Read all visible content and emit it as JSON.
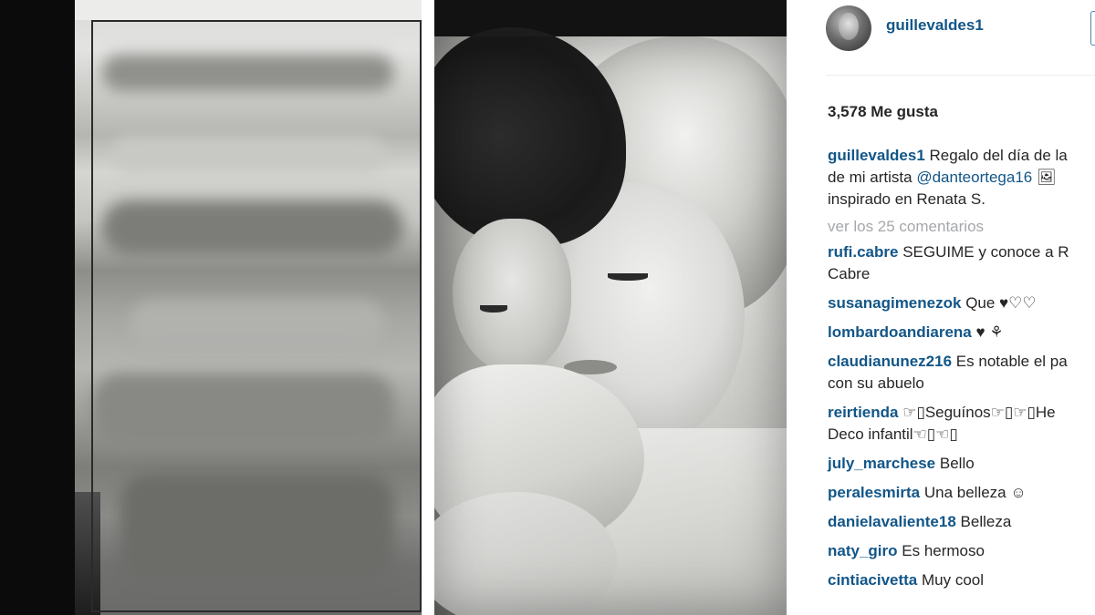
{
  "post": {
    "username": "guillevaldes1",
    "likes_text": "3,578 Me gusta",
    "caption": {
      "user": "guillevaldes1",
      "line1": "Regalo del día de la",
      "line2_prefix": "de mi artista",
      "mention": "@danteortega16",
      "line2_suffix": "🖼",
      "line3": "inspirado en Renata S."
    },
    "view_all_comments": "ver los 25 comentarios",
    "comments": [
      {
        "user": "rufi.cabre",
        "text": "SEGUIME y conoce a R",
        "text2": "Cabre"
      },
      {
        "user": "susanagimenezok",
        "text": "Que ♥♡♡"
      },
      {
        "user": "lombardoandiarena",
        "text": "♥ ⚘"
      },
      {
        "user": "claudianunez216",
        "text": "Es notable el pa",
        "text2": "con su abuelo"
      },
      {
        "user": "reirtienda",
        "text": "☞▯Seguínos☞▯☞▯He",
        "text2": "Deco infantil☜▯☜▯"
      },
      {
        "user": "july_marchese",
        "text": "Bello"
      },
      {
        "user": "peralesmirta",
        "text": "Una belleza ☺"
      },
      {
        "user": "danielavaliente18",
        "text": "Belleza"
      },
      {
        "user": "naty_giro",
        "text": "Es hermoso"
      },
      {
        "user": "cintiacivetta",
        "text": "Muy cool"
      }
    ]
  },
  "colors": {
    "link_blue": "#125688",
    "text": "#262626",
    "muted": "#a5a7aa"
  },
  "icons": {
    "avatar": "profile-avatar-icon"
  }
}
